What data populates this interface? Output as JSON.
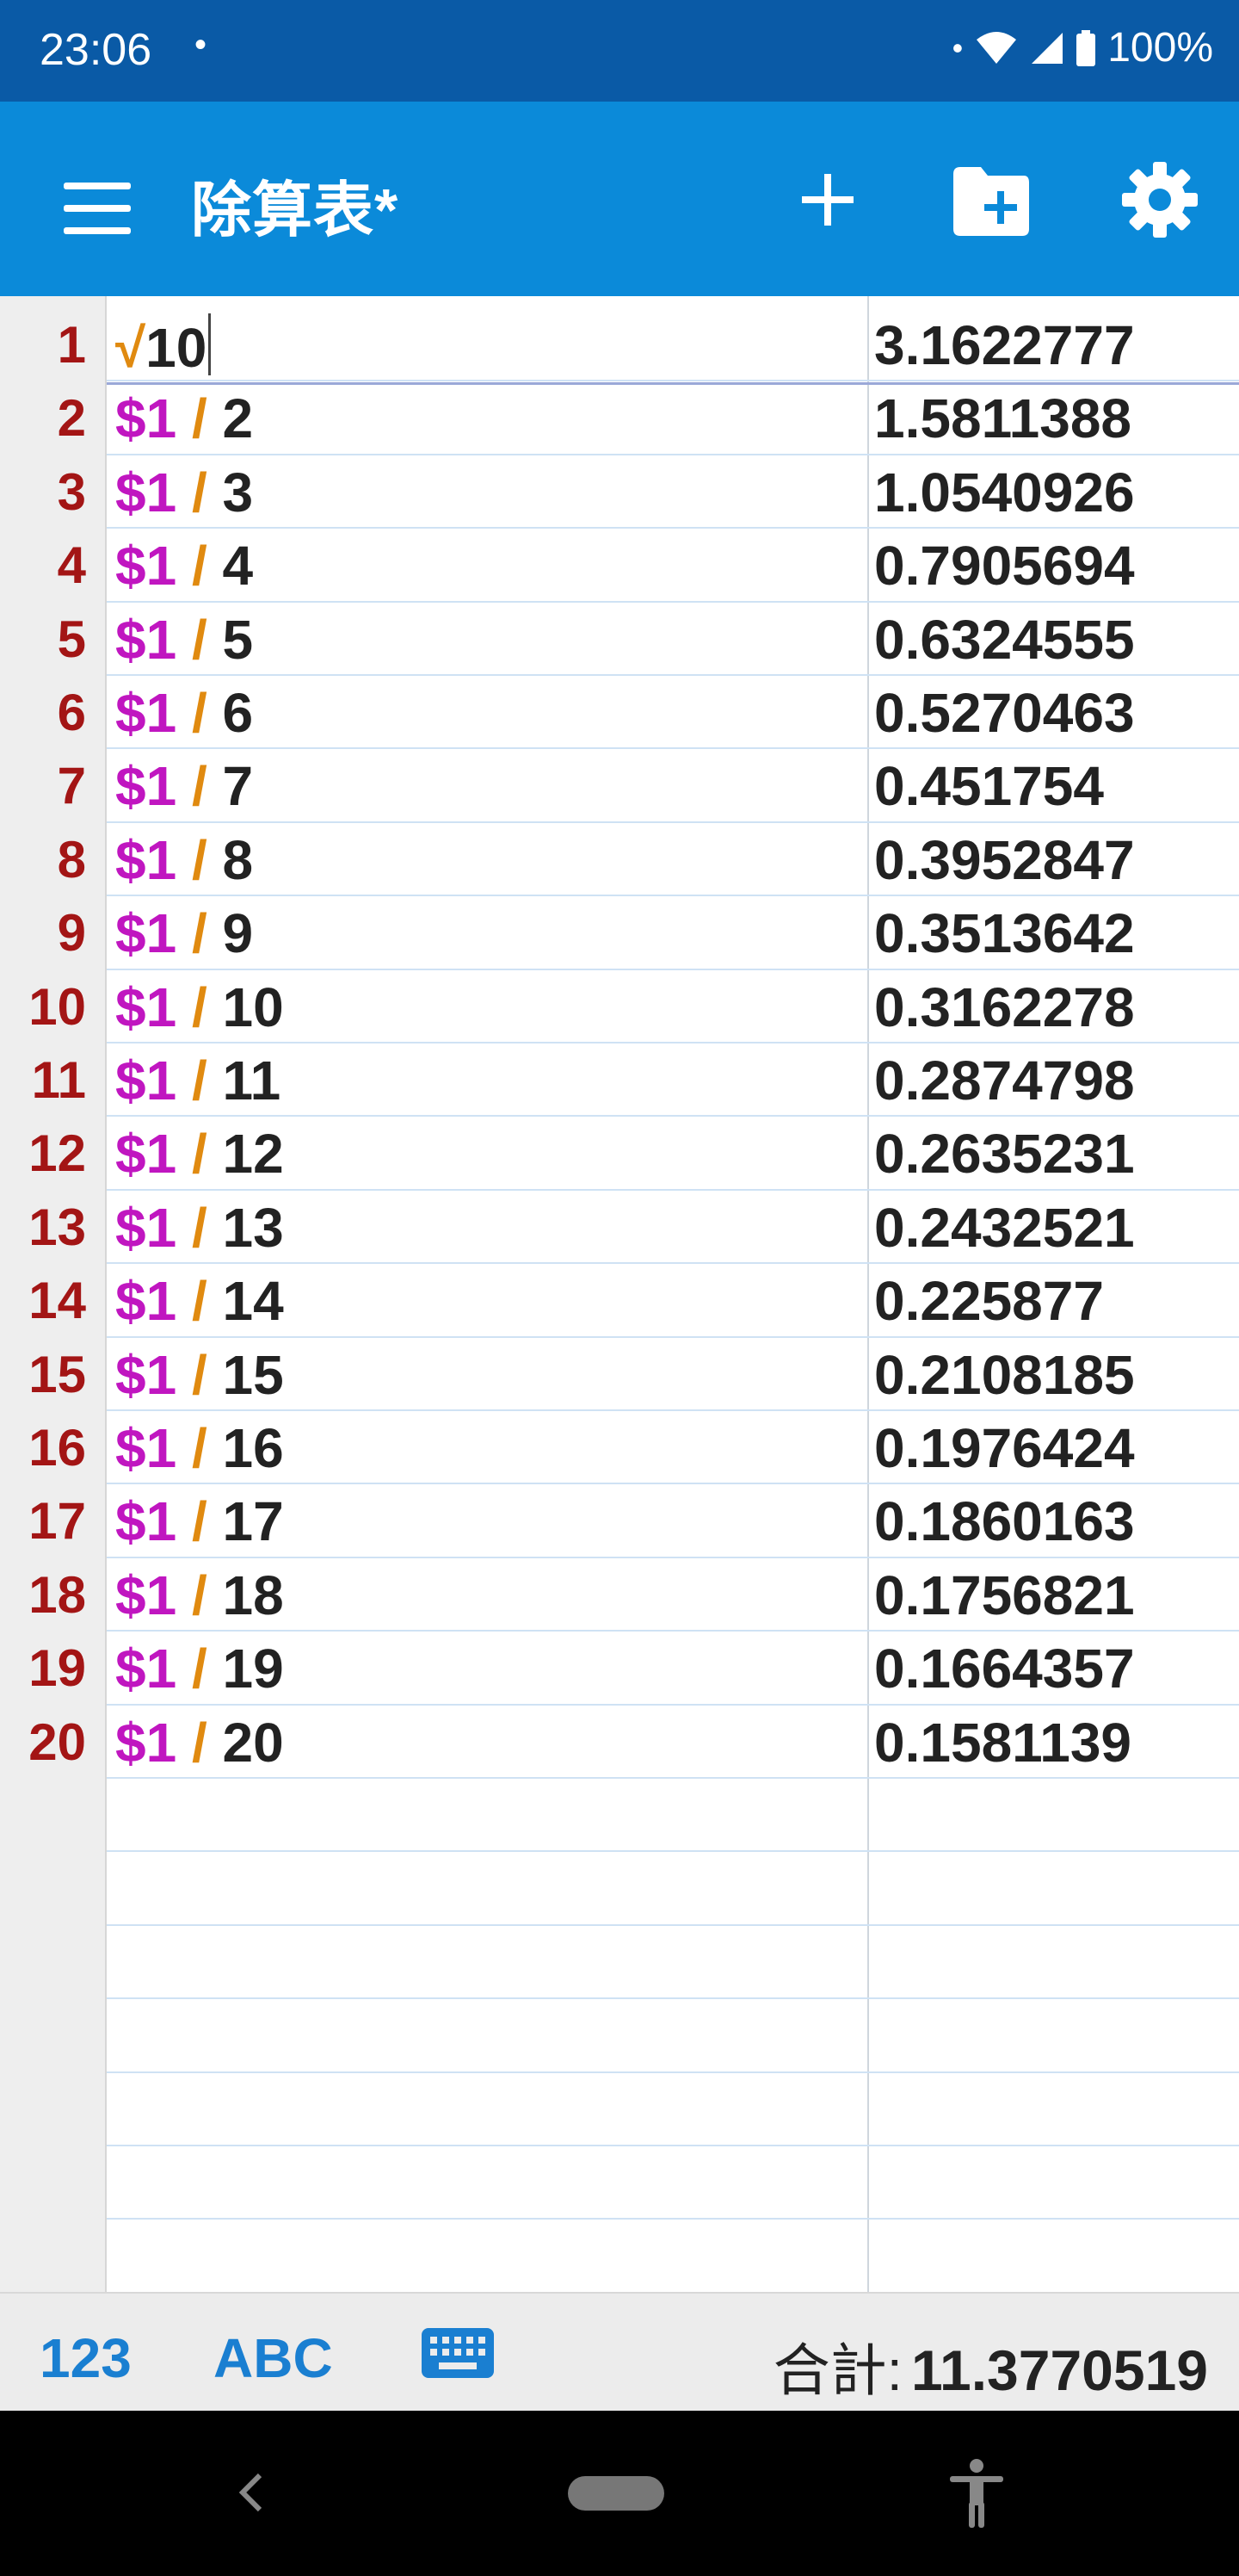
{
  "status_bar": {
    "time": "23:06",
    "dot": "•",
    "battery": "100%"
  },
  "app_bar": {
    "title": "除算表*"
  },
  "icons": {
    "menu": "menu-icon",
    "add": "plus-icon",
    "folder": "folder-add-icon",
    "settings": "gear-icon"
  },
  "colors": {
    "app_bar": "#0b8ad9",
    "status_bar": "#0a5aa6",
    "row_number": "#a31515",
    "reference": "#c016c0",
    "operator": "#e08a10"
  },
  "rows": [
    {
      "num": "1",
      "ref": "",
      "op": "√",
      "val": "10",
      "result": "3.1622777"
    },
    {
      "num": "2",
      "ref": "$1",
      "op": "/",
      "val": "2",
      "result": "1.5811388"
    },
    {
      "num": "3",
      "ref": "$1",
      "op": "/",
      "val": "3",
      "result": "1.0540926"
    },
    {
      "num": "4",
      "ref": "$1",
      "op": "/",
      "val": "4",
      "result": "0.7905694"
    },
    {
      "num": "5",
      "ref": "$1",
      "op": "/",
      "val": "5",
      "result": "0.6324555"
    },
    {
      "num": "6",
      "ref": "$1",
      "op": "/",
      "val": "6",
      "result": "0.5270463"
    },
    {
      "num": "7",
      "ref": "$1",
      "op": "/",
      "val": "7",
      "result": "0.451754"
    },
    {
      "num": "8",
      "ref": "$1",
      "op": "/",
      "val": "8",
      "result": "0.3952847"
    },
    {
      "num": "9",
      "ref": "$1",
      "op": "/",
      "val": "9",
      "result": "0.3513642"
    },
    {
      "num": "10",
      "ref": "$1",
      "op": "/",
      "val": "10",
      "result": "0.3162278"
    },
    {
      "num": "11",
      "ref": "$1",
      "op": "/",
      "val": "11",
      "result": "0.2874798"
    },
    {
      "num": "12",
      "ref": "$1",
      "op": "/",
      "val": "12",
      "result": "0.2635231"
    },
    {
      "num": "13",
      "ref": "$1",
      "op": "/",
      "val": "13",
      "result": "0.2432521"
    },
    {
      "num": "14",
      "ref": "$1",
      "op": "/",
      "val": "14",
      "result": "0.225877"
    },
    {
      "num": "15",
      "ref": "$1",
      "op": "/",
      "val": "15",
      "result": "0.2108185"
    },
    {
      "num": "16",
      "ref": "$1",
      "op": "/",
      "val": "16",
      "result": "0.1976424"
    },
    {
      "num": "17",
      "ref": "$1",
      "op": "/",
      "val": "17",
      "result": "0.1860163"
    },
    {
      "num": "18",
      "ref": "$1",
      "op": "/",
      "val": "18",
      "result": "0.1756821"
    },
    {
      "num": "19",
      "ref": "$1",
      "op": "/",
      "val": "19",
      "result": "0.1664357"
    },
    {
      "num": "20",
      "ref": "$1",
      "op": "/",
      "val": "20",
      "result": "0.1581139"
    }
  ],
  "bottom_bar": {
    "numeric_label": "123",
    "alpha_label": "ABC",
    "sum_label": "合計:",
    "sum_value": "11.3770519"
  }
}
